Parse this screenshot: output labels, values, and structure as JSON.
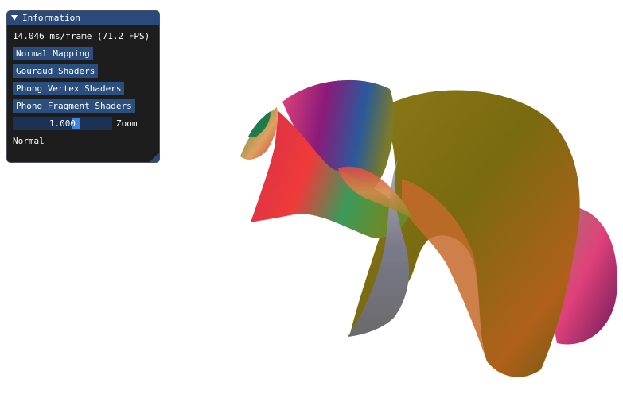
{
  "panel": {
    "title": "Information",
    "frame_stats": "14.046 ms/frame (71.2 FPS)",
    "buttons": [
      {
        "label": "Normal Mapping"
      },
      {
        "label": "Gouraud Shaders"
      },
      {
        "label": "Phong Vertex Shaders"
      },
      {
        "label": "Phong Fragment Shaders"
      }
    ],
    "zoom": {
      "value_text": "1.000",
      "value": 1.0,
      "label": "Zoom"
    },
    "mode_text": "Normal"
  },
  "colors": {
    "panel_bg": "#0f0f0f",
    "title_bar": "#294a7a",
    "button": "#2a4f7e",
    "slider_bg": "#1b3254",
    "slider_grab": "#3d85e0"
  }
}
